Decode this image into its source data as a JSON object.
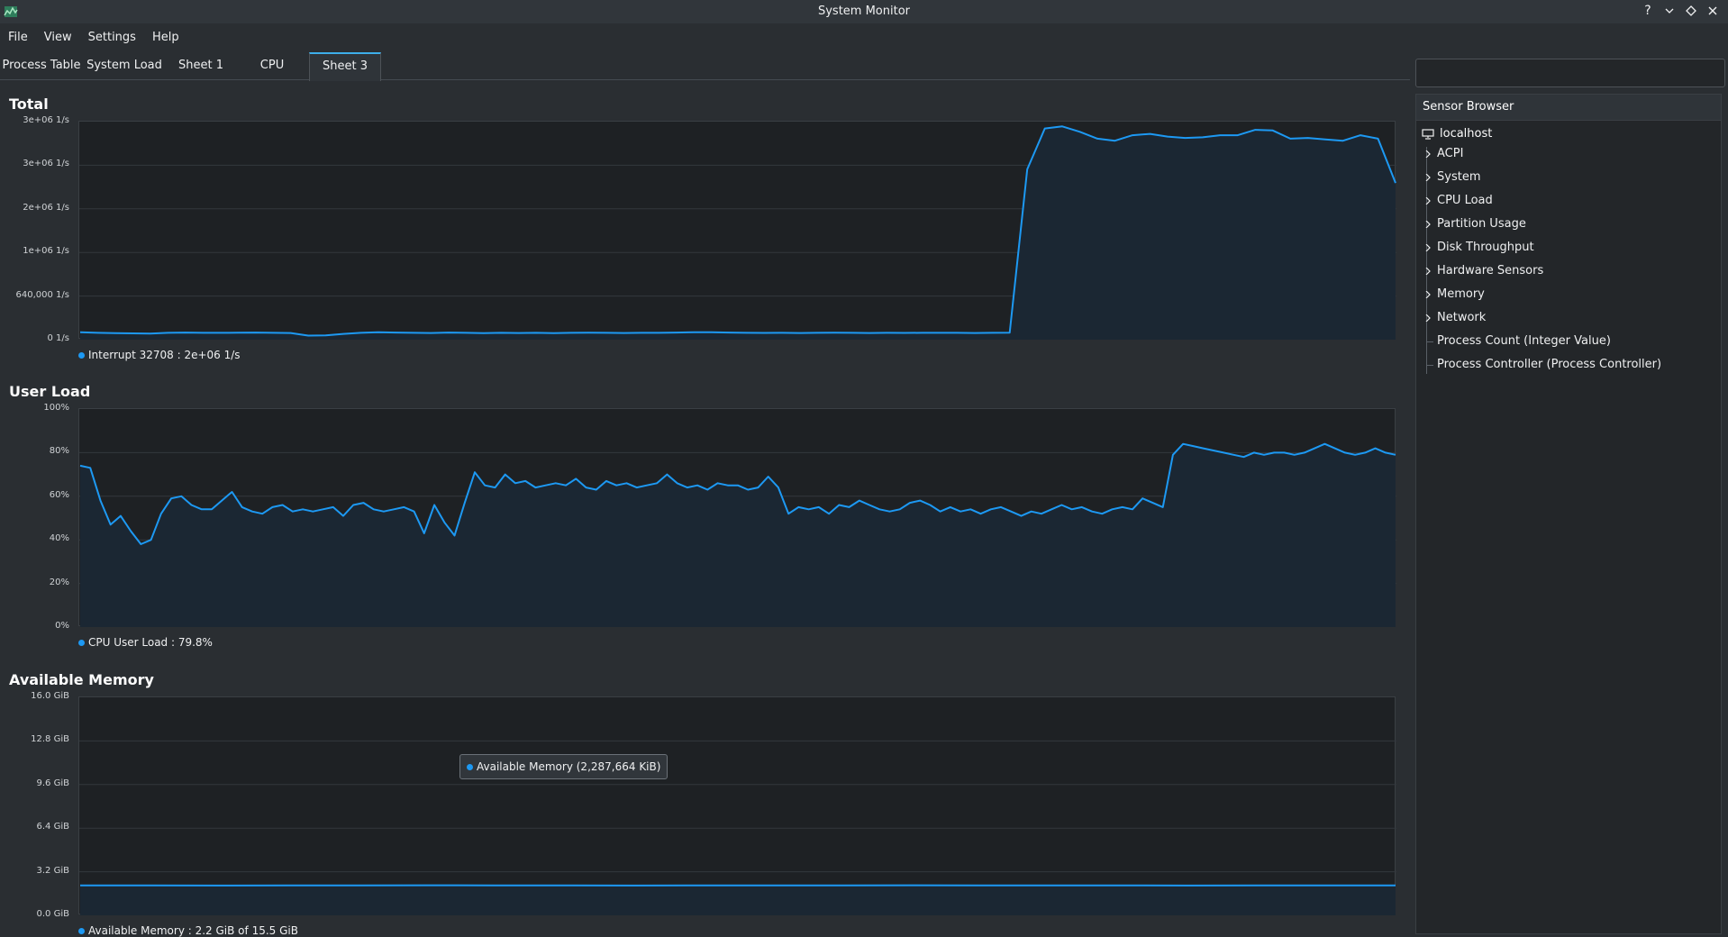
{
  "window": {
    "title": "System Monitor"
  },
  "menu": [
    "File",
    "View",
    "Settings",
    "Help"
  ],
  "tabs": [
    "Process Table",
    "System Load",
    "Sheet 1",
    "CPU",
    "Sheet 3"
  ],
  "active_tab": "Sheet 3",
  "search": {
    "placeholder": ""
  },
  "sensor_browser": {
    "header": "Sensor Browser",
    "root": "localhost",
    "items": [
      {
        "label": "ACPI",
        "expandable": true
      },
      {
        "label": "System",
        "expandable": true
      },
      {
        "label": "CPU Load",
        "expandable": true
      },
      {
        "label": "Partition Usage",
        "expandable": true
      },
      {
        "label": "Disk Throughput",
        "expandable": true
      },
      {
        "label": "Hardware Sensors",
        "expandable": true
      },
      {
        "label": "Memory",
        "expandable": true
      },
      {
        "label": "Network",
        "expandable": true
      },
      {
        "label": "Process Count (Integer Value)",
        "expandable": false
      },
      {
        "label": "Process Controller (Process Controller)",
        "expandable": false
      }
    ]
  },
  "tooltip": "Available Memory (2,287,664 KiB)",
  "colors": {
    "accent": "#3daee9",
    "line": "#1d99f3",
    "fill": "#1b2733",
    "plot_bg": "#1e2124"
  },
  "chart_data": [
    {
      "type": "area",
      "title": "Total",
      "yticks": [
        "3e+06 1/s",
        "3e+06 1/s",
        "2e+06 1/s",
        "1e+06 1/s",
        "640,000 1/s",
        "0 1/s"
      ],
      "ylim": [
        0,
        3200000
      ],
      "legend": "Interrupt 32708 : 2e+06 1/s",
      "series": [
        {
          "name": "Interrupt 32708",
          "values": [
            110000,
            100000,
            95000,
            92000,
            90000,
            100000,
            105000,
            100000,
            100000,
            102000,
            104000,
            100000,
            98000,
            60000,
            62000,
            85000,
            100000,
            110000,
            105000,
            100000,
            98000,
            104000,
            100000,
            96000,
            100000,
            98000,
            100000,
            97000,
            100000,
            102000,
            100000,
            98000,
            100000,
            101000,
            105000,
            110000,
            108000,
            104000,
            100000,
            99000,
            100000,
            98000,
            100000,
            102000,
            100000,
            98000,
            100000,
            99000,
            101000,
            100000,
            100000,
            98000,
            100000,
            102000,
            2500000,
            3100000,
            3130000,
            3050000,
            2950000,
            2920000,
            3000000,
            3020000,
            2980000,
            2960000,
            2970000,
            3000000,
            3000000,
            3080000,
            3070000,
            2950000,
            2960000,
            2940000,
            2920000,
            3000000,
            2950000,
            2300000
          ]
        }
      ]
    },
    {
      "type": "area",
      "title": "User Load",
      "yticks": [
        "100%",
        "80%",
        "60%",
        "40%",
        "20%",
        "0%"
      ],
      "ylim": [
        0,
        100
      ],
      "legend": "CPU User Load : 79.8%",
      "series": [
        {
          "name": "CPU User Load",
          "values": [
            74,
            73,
            58,
            47,
            51,
            44,
            38,
            40,
            52,
            59,
            60,
            56,
            54,
            54,
            58,
            62,
            55,
            53,
            52,
            55,
            56,
            53,
            54,
            53,
            54,
            55,
            51,
            56,
            57,
            54,
            53,
            54,
            55,
            53,
            43,
            56,
            48,
            42,
            57,
            71,
            65,
            64,
            70,
            66,
            67,
            64,
            65,
            66,
            65,
            68,
            64,
            63,
            67,
            65,
            66,
            64,
            65,
            66,
            70,
            66,
            64,
            65,
            63,
            66,
            65,
            65,
            63,
            64,
            69,
            64,
            52,
            55,
            54,
            55,
            52,
            56,
            55,
            58,
            56,
            54,
            53,
            54,
            57,
            58,
            56,
            53,
            55,
            53,
            54,
            52,
            54,
            55,
            53,
            51,
            53,
            52,
            54,
            56,
            54,
            55,
            53,
            52,
            54,
            55,
            54,
            59,
            57,
            55,
            79,
            84,
            83,
            82,
            81,
            80,
            79,
            78,
            80,
            79,
            80,
            80,
            79,
            80,
            82,
            84,
            82,
            80,
            79,
            80,
            82,
            80,
            79
          ]
        }
      ]
    },
    {
      "type": "area",
      "title": "Available Memory",
      "yticks": [
        "16.0 GiB",
        "12.8 GiB",
        "9.6 GiB",
        "6.4 GiB",
        "3.2 GiB",
        "0.0 GiB"
      ],
      "ylim": [
        0,
        16
      ],
      "legend": "Available Memory : 2.2 GiB of 15.5 GiB",
      "series": [
        {
          "name": "Available Memory",
          "values": [
            2.2,
            2.2,
            2.19,
            2.2,
            2.2,
            2.21,
            2.2,
            2.2,
            2.19,
            2.2,
            2.2,
            2.2,
            2.21,
            2.2,
            2.2,
            2.2,
            2.19,
            2.2,
            2.2,
            2.2
          ]
        }
      ]
    }
  ]
}
